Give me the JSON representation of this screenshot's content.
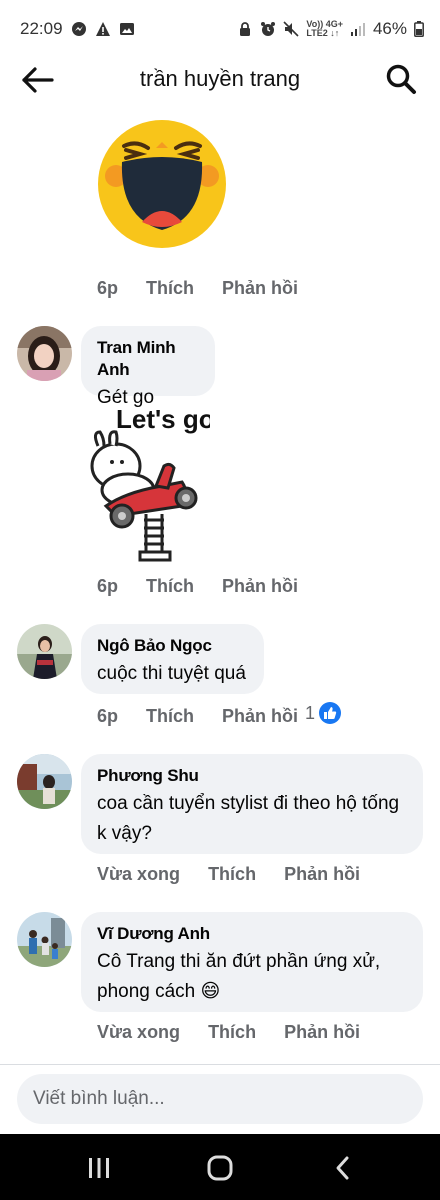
{
  "status_bar": {
    "time": "22:09",
    "network_top": "Vo)) 4G+",
    "network_bottom": "LTE2 ↓↑",
    "battery": "46%"
  },
  "header": {
    "title": "trần huyền trang",
    "icons": [
      "back-arrow-icon",
      "search-icon"
    ]
  },
  "comments": [
    {
      "sticker": "laughing-face-sticker",
      "time": "6p",
      "like_label": "Thích",
      "reply_label": "Phản hồi"
    },
    {
      "author": "Tran Minh Anh",
      "text": "Gét go",
      "sticker_text": "Let's go",
      "time": "6p",
      "like_label": "Thích",
      "reply_label": "Phản hồi"
    },
    {
      "author": "Ngô Bảo Ngọc",
      "text": "cuộc thi tuyệt quá",
      "time": "6p",
      "like_label": "Thích",
      "reply_label": "Phản hồi",
      "reaction_count": "1",
      "reaction_icon": "like-reaction-icon"
    },
    {
      "author": "Phương Shu",
      "text_line1": "coa cần tuyển stylist đi theo hộ tống",
      "text_line2": "k vậy?",
      "time": "Vừa xong",
      "like_label": "Thích",
      "reply_label": "Phản hồi"
    },
    {
      "author": "Vĩ Dương Anh",
      "text_line1": "Cô Trang thi ăn đứt phần ứng xử,",
      "text_line2": "phong cách",
      "emoji": "😄",
      "time": "Vừa xong",
      "like_label": "Thích",
      "reply_label": "Phản hồi"
    }
  ],
  "composer": {
    "placeholder": "Viết bình luận..."
  },
  "colors": {
    "bubble": "#f0f2f5",
    "meta_text": "#65676b",
    "like_blue": "#1877f2",
    "navbar": "#000000"
  }
}
